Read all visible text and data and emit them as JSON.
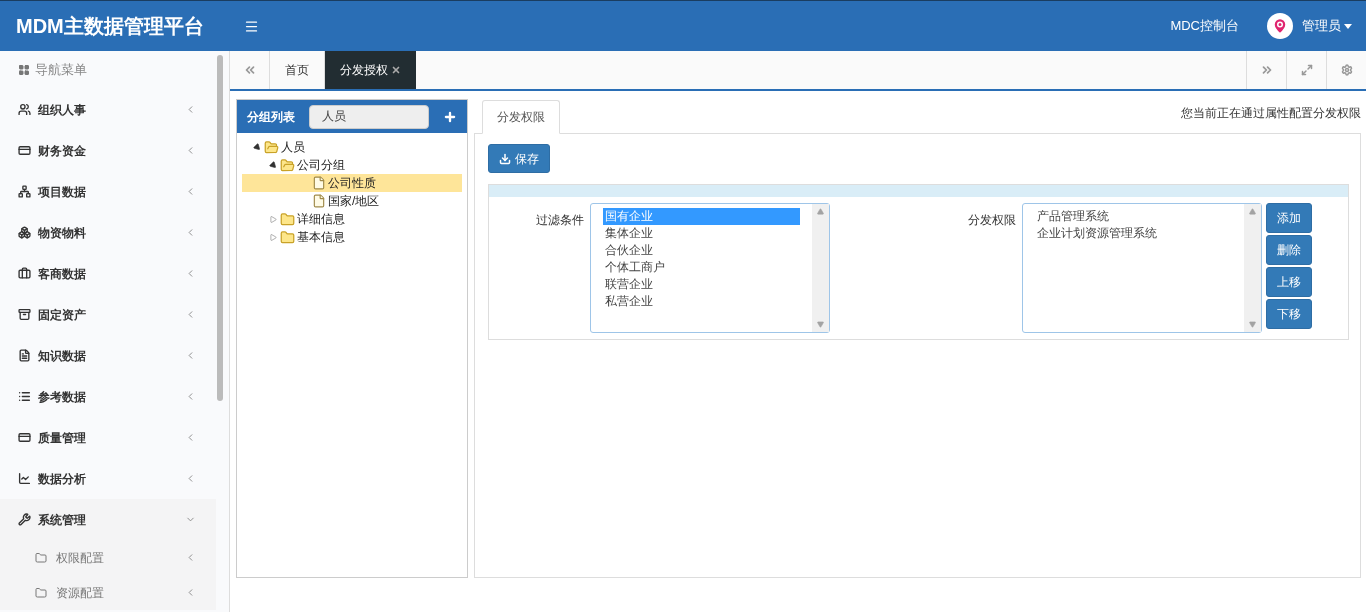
{
  "header": {
    "title": "MDM主数据管理平台",
    "console_link": "MDC控制台",
    "user": "管理员"
  },
  "sidebar": {
    "heading": "导航菜单",
    "items": [
      {
        "label": "组织人事",
        "expanded": false
      },
      {
        "label": "财务资金",
        "expanded": false
      },
      {
        "label": "项目数据",
        "expanded": false
      },
      {
        "label": "物资物料",
        "expanded": false
      },
      {
        "label": "客商数据",
        "expanded": false
      },
      {
        "label": "固定资产",
        "expanded": false
      },
      {
        "label": "知识数据",
        "expanded": false
      },
      {
        "label": "参考数据",
        "expanded": false
      },
      {
        "label": "质量管理",
        "expanded": false
      },
      {
        "label": "数据分析",
        "expanded": false
      },
      {
        "label": "系统管理",
        "expanded": true,
        "children": [
          {
            "label": "权限配置",
            "expanded": false
          },
          {
            "label": "资源配置",
            "expanded": false
          }
        ]
      }
    ]
  },
  "tabs": [
    {
      "label": "首页",
      "selected": false
    },
    {
      "label": "分发授权",
      "selected": true
    }
  ],
  "group_panel": {
    "title": "分组列表",
    "search_value": "人员",
    "tree": [
      {
        "label": "人员",
        "kind": "folder",
        "expanded": true,
        "selected": false,
        "children": [
          {
            "label": "公司分组",
            "kind": "folder",
            "expanded": true,
            "selected": false,
            "children": [
              {
                "label": "公司性质",
                "kind": "file",
                "selected": true
              },
              {
                "label": "国家/地区",
                "kind": "file",
                "selected": false
              }
            ]
          },
          {
            "label": "详细信息",
            "kind": "folder",
            "expanded": false,
            "selected": false
          },
          {
            "label": "基本信息",
            "kind": "folder",
            "expanded": false,
            "selected": false
          }
        ]
      }
    ]
  },
  "content": {
    "tab": "分发权限",
    "hint": "您当前正在通过属性配置分发权限",
    "save_button": "保存",
    "filter": {
      "label": "过滤条件",
      "options": [
        {
          "label": "国有企业",
          "selected": true
        },
        {
          "label": "集体企业",
          "selected": false
        },
        {
          "label": "合伙企业",
          "selected": false
        },
        {
          "label": "个体工商户",
          "selected": false
        },
        {
          "label": "联营企业",
          "selected": false
        },
        {
          "label": "私营企业",
          "selected": false
        }
      ]
    },
    "permissions": {
      "label": "分发权限",
      "options": [
        {
          "label": "产品管理系统",
          "selected": false
        },
        {
          "label": "企业计划资源管理系统",
          "selected": false
        }
      ]
    },
    "buttons": [
      "添加",
      "删除",
      "上移",
      "下移"
    ]
  }
}
